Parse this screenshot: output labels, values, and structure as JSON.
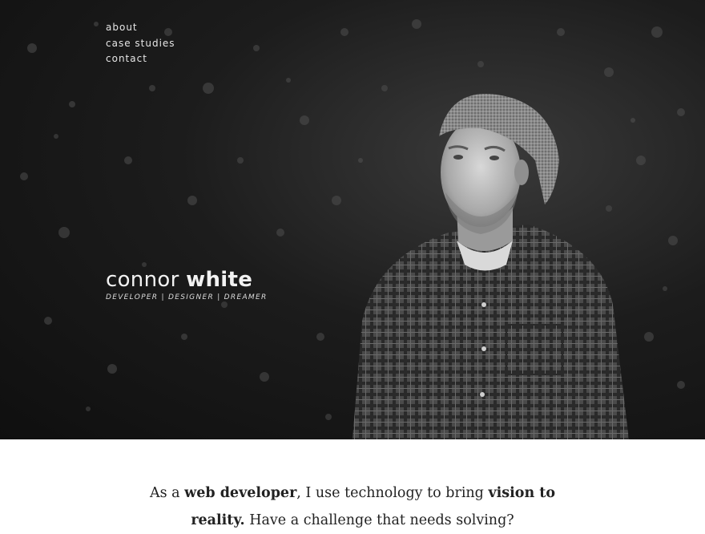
{
  "nav": {
    "items": [
      {
        "label": "about"
      },
      {
        "label": "case studies"
      },
      {
        "label": "contact"
      }
    ]
  },
  "hero": {
    "first_name": "connor",
    "last_name": "white",
    "tagline": "DEVELOPER | DESIGNER | DREAMER"
  },
  "intro": {
    "line1_a": "As a ",
    "line1_b": "web developer",
    "line1_c": ", I use technology to bring ",
    "line1_d": "vision to",
    "line2_a": "reality.",
    "line2_b": " Have a challenge that needs solving?"
  },
  "colors": {
    "hero_background": "#1c1c1c",
    "nav_text": "#e6e6e6",
    "body_text": "#222222",
    "page_background": "#ffffff"
  }
}
